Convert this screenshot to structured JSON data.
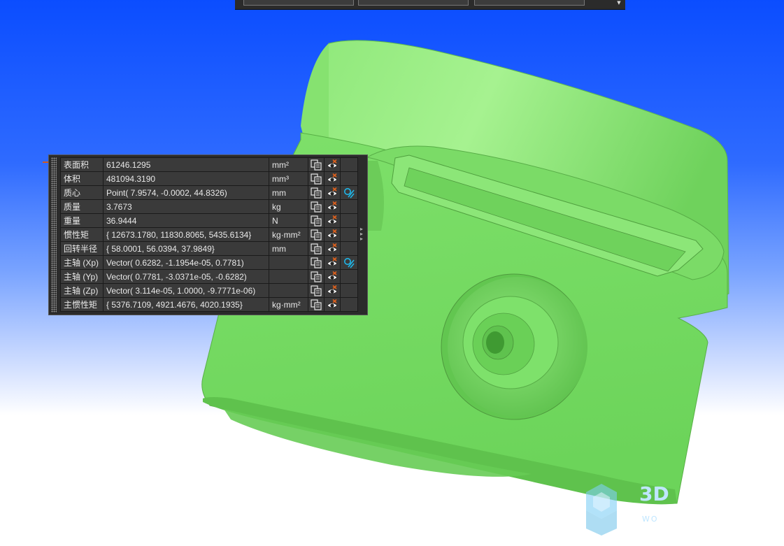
{
  "colors": {
    "model_fill": "#74dc63",
    "model_highlight": "#a3f08c",
    "panel_bg": "#2b2b2b",
    "cell_bg": "#3a3a3a",
    "accent_cyan": "#1fb6e8",
    "accent_orange": "#e0611c"
  },
  "properties": {
    "rows": [
      {
        "name": "表面积",
        "value": "61246.1295",
        "unit": "mm²",
        "has_link": false
      },
      {
        "name": "体积",
        "value": "481094.3190",
        "unit": "mm³",
        "has_link": false
      },
      {
        "name": "质心",
        "value": "Point( 7.9574, -0.0002, 44.8326)",
        "unit": "mm",
        "has_link": true
      },
      {
        "name": "质量",
        "value": "3.7673",
        "unit": "kg",
        "has_link": false
      },
      {
        "name": "重量",
        "value": "36.9444",
        "unit": "N",
        "has_link": false
      },
      {
        "name": "惯性矩",
        "value": "{ 12673.1780, 11830.8065, 5435.6134}",
        "unit": "kg·mm²",
        "has_link": false
      },
      {
        "name": "回转半径",
        "value": "{ 58.0001, 56.0394, 37.9849}",
        "unit": "mm",
        "has_link": false
      },
      {
        "name": "主轴 (Xp)",
        "value": "Vector( 0.6282, -1.1954e-05, 0.7781)",
        "unit": "",
        "has_link": true
      },
      {
        "name": "主轴 (Yp)",
        "value": "Vector( 0.7781, -3.0371e-05, -0.6282)",
        "unit": "",
        "has_link": false
      },
      {
        "name": "主轴 (Zp)",
        "value": "Vector( 3.114e-05, 1.0000, -9.7771e-06)",
        "unit": "",
        "has_link": false
      },
      {
        "name": "主惯性矩",
        "value": "{ 5376.7109, 4921.4676, 4020.1935}",
        "unit": "kg·mm²",
        "has_link": false
      }
    ],
    "icons": {
      "copy": "copy-icon",
      "visibility": "eye-toggle-icon",
      "link": "link-icon"
    }
  },
  "toolbar": {
    "combos": [
      "",
      "",
      ""
    ],
    "dropdown_icon": "chevron-down-icon"
  },
  "watermark": {
    "text": "3D",
    "sub": "WO"
  }
}
